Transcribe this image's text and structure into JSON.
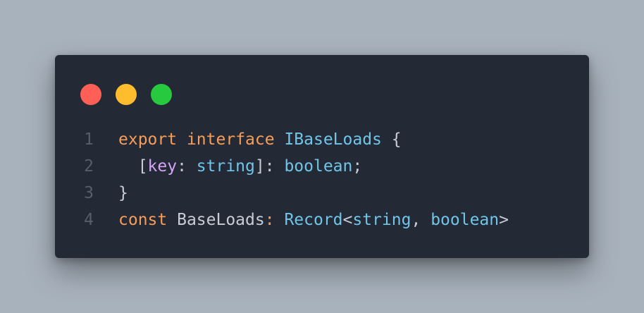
{
  "window": {
    "controls": [
      "close",
      "minimize",
      "maximize"
    ],
    "colors": {
      "close": "#ff5f56",
      "minimize": "#ffbd2e",
      "maximize": "#27c93f",
      "background": "#232935"
    }
  },
  "code": {
    "lines": [
      {
        "number": "1",
        "tokens": [
          {
            "text": "export",
            "kind": "kw"
          },
          {
            "text": " ",
            "kind": "plain"
          },
          {
            "text": "interface",
            "kind": "kw"
          },
          {
            "text": " ",
            "kind": "plain"
          },
          {
            "text": "IBaseLoads",
            "kind": "type"
          },
          {
            "text": " {",
            "kind": "punct"
          }
        ]
      },
      {
        "number": "2",
        "tokens": [
          {
            "text": "  [",
            "kind": "punct"
          },
          {
            "text": "key",
            "kind": "prop"
          },
          {
            "text": ": ",
            "kind": "punct"
          },
          {
            "text": "string",
            "kind": "type"
          },
          {
            "text": "]: ",
            "kind": "punct"
          },
          {
            "text": "boolean",
            "kind": "type"
          },
          {
            "text": ";",
            "kind": "punct"
          }
        ]
      },
      {
        "number": "3",
        "tokens": [
          {
            "text": "}",
            "kind": "punct"
          }
        ]
      },
      {
        "number": "4",
        "tokens": [
          {
            "text": "const",
            "kind": "kw"
          },
          {
            "text": " BaseLoads",
            "kind": "plain"
          },
          {
            "text": ": ",
            "kind": "kw"
          },
          {
            "text": "Record",
            "kind": "type"
          },
          {
            "text": "<",
            "kind": "punct"
          },
          {
            "text": "string",
            "kind": "type"
          },
          {
            "text": ", ",
            "kind": "punct"
          },
          {
            "text": "boolean",
            "kind": "type"
          },
          {
            "text": ">",
            "kind": "punct"
          }
        ]
      }
    ]
  }
}
